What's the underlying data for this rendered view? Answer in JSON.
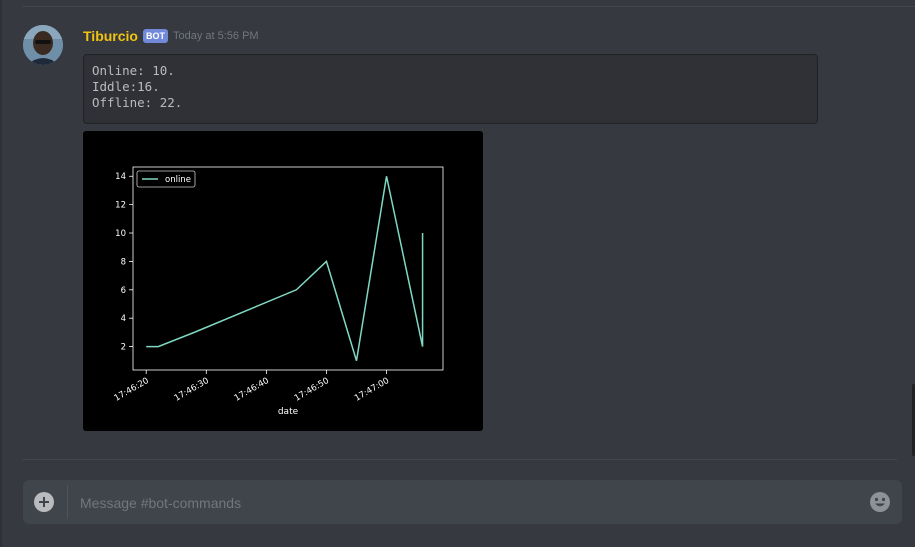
{
  "message": {
    "author": "Tiburcio",
    "tag": "BOT",
    "timestamp": "Today at 5:56 PM",
    "code_lines": [
      "Online: 10.",
      "Iddle:16.",
      "Offline: 22."
    ]
  },
  "chart_data": {
    "type": "line",
    "title": "",
    "xlabel": "date",
    "ylabel": "",
    "x_tick_labels": [
      "17:46:20",
      "17:46:30",
      "17:46:40",
      "17:46:50",
      "17:47:00"
    ],
    "x_tick_seconds": [
      20,
      30,
      40,
      50,
      60
    ],
    "y_ticks": [
      2,
      4,
      6,
      8,
      10,
      12,
      14
    ],
    "xlim": [
      17.8,
      69.4
    ],
    "ylim": [
      0.35,
      14.65
    ],
    "legend": "top-left",
    "series": [
      {
        "name": "online",
        "color": "#7fd8c3",
        "x": [
          "17:46:20",
          "17:46:22",
          "17:46:28",
          "17:46:45",
          "17:46:50",
          "17:46:55",
          "17:47:00",
          "17:47:06",
          "17:47:06",
          "17:47:06"
        ],
        "y": [
          2,
          2,
          3,
          6,
          8,
          1,
          14,
          2,
          10,
          6
        ]
      }
    ]
  },
  "composer": {
    "placeholder": "Message #bot-commands"
  },
  "icons": {
    "attach": "plus-circle-icon",
    "emoji": "smiley-icon"
  }
}
